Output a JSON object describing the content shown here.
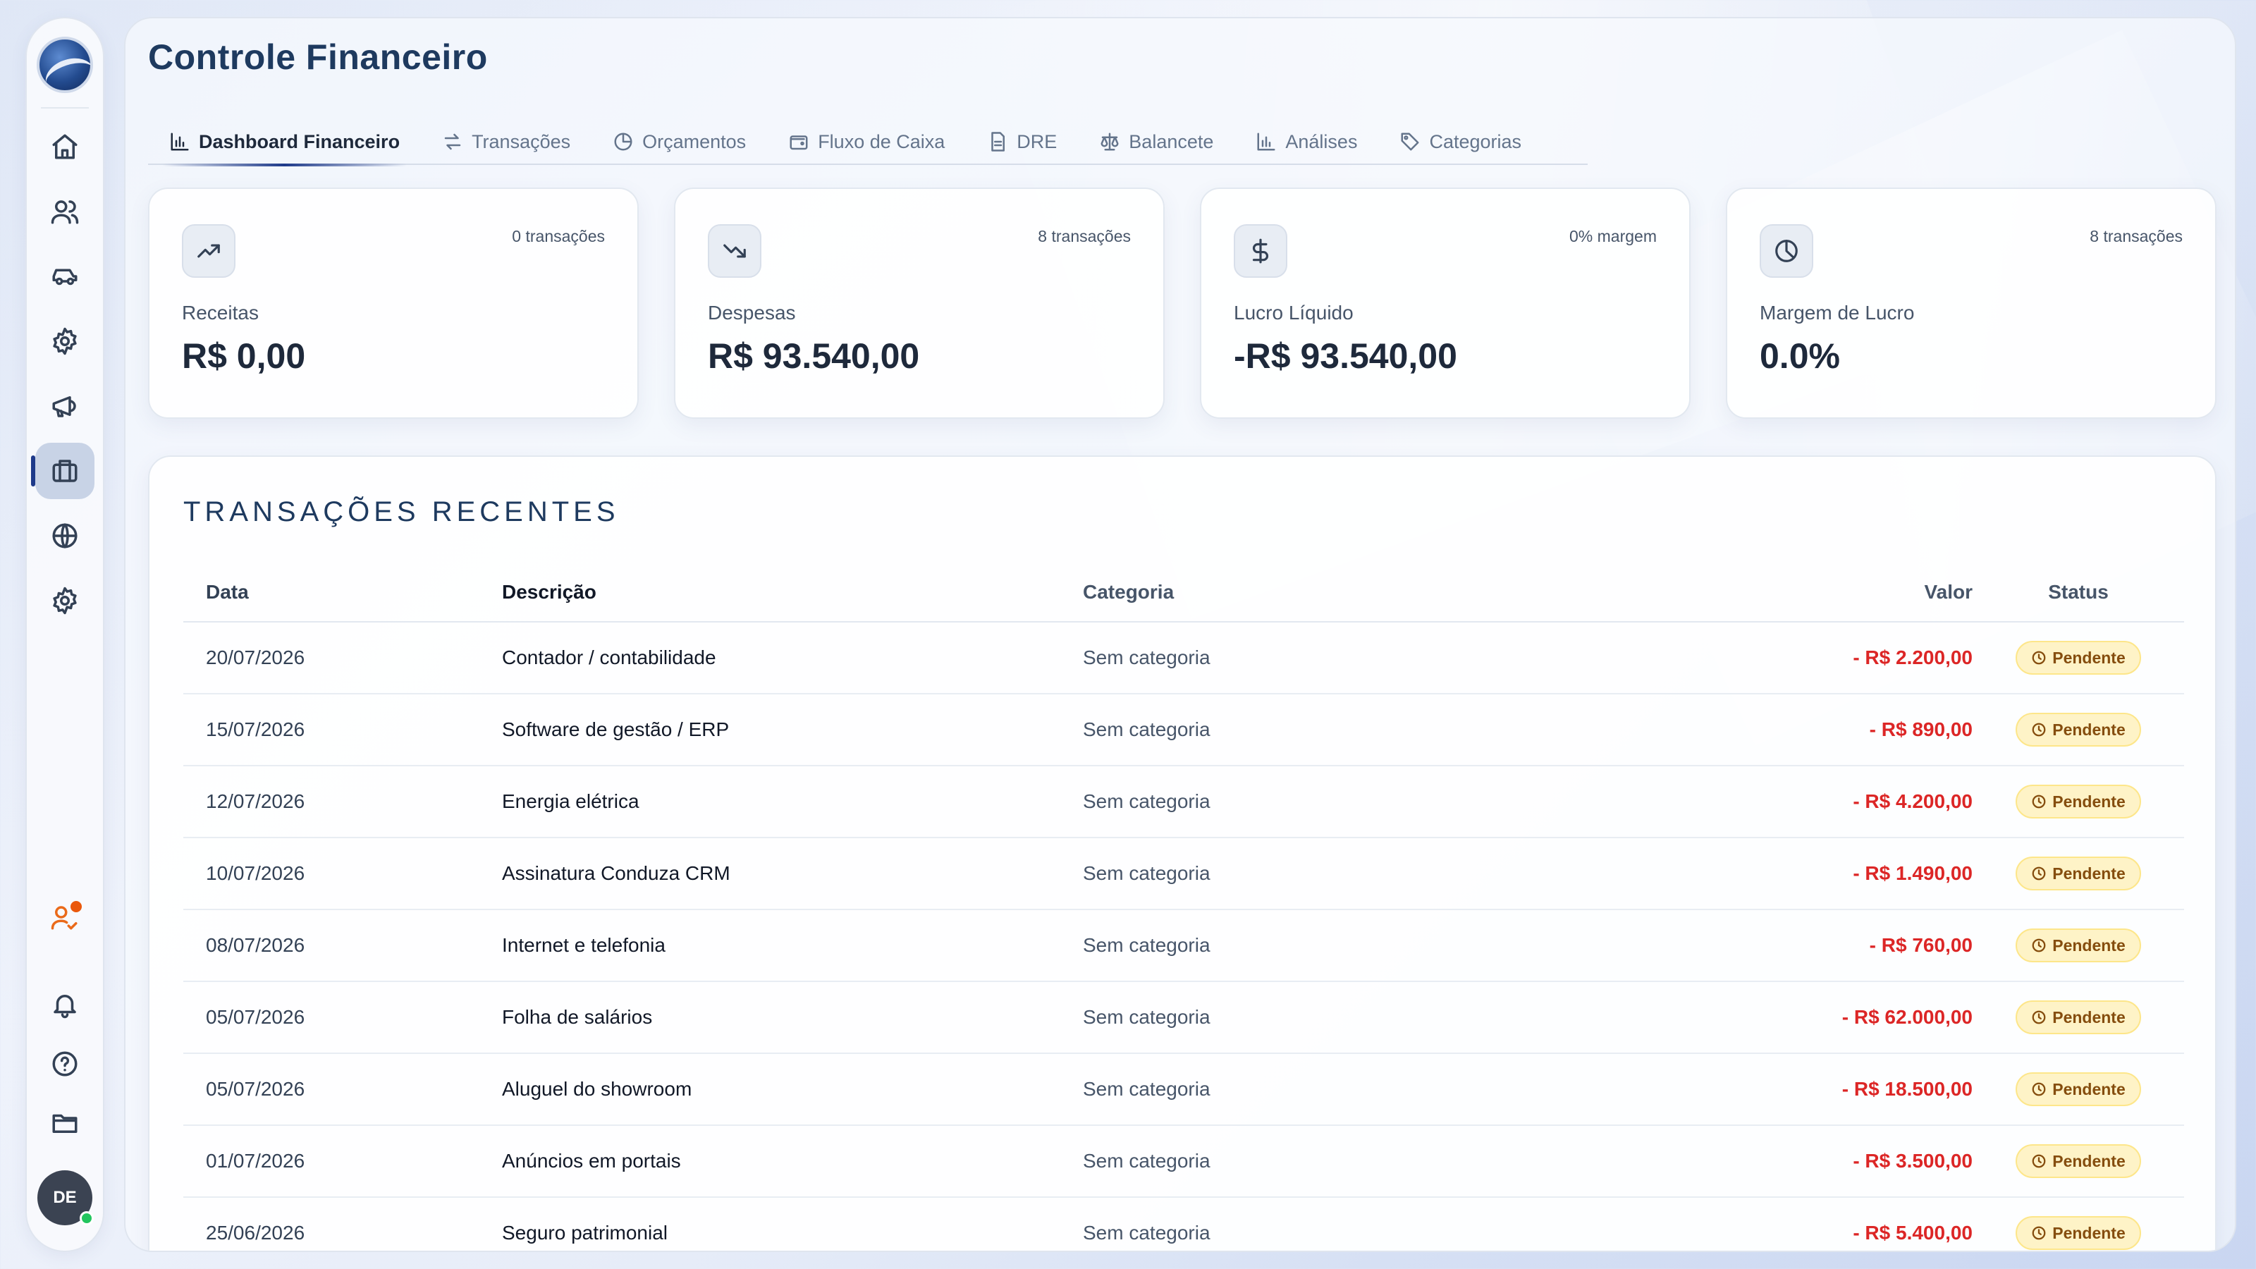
{
  "colors": {
    "accent": "#1e3a8a",
    "negative": "#dc2626",
    "pending_bg": "#fef3c7",
    "pending_text": "#854d0e",
    "notification": "#ea580c",
    "online": "#22c55e"
  },
  "sidebar": {
    "logo_icon": "company-logo",
    "items": [
      {
        "icon": "home-icon",
        "active": false
      },
      {
        "icon": "users-icon",
        "active": false
      },
      {
        "icon": "car-icon",
        "active": false
      },
      {
        "icon": "settings-icon",
        "active": false
      },
      {
        "icon": "megaphone-icon",
        "active": false
      },
      {
        "icon": "briefcase-icon",
        "active": true
      },
      {
        "icon": "globe-icon",
        "active": false
      },
      {
        "icon": "settings-icon",
        "active": false
      }
    ],
    "bottom_items": [
      {
        "icon": "user-check-icon",
        "has_notification": true
      },
      {
        "icon": "bell-icon"
      },
      {
        "icon": "help-circle-icon"
      },
      {
        "icon": "folder-icon"
      }
    ],
    "avatar_initials": "DE"
  },
  "page": {
    "title": "Controle Financeiro"
  },
  "tabs": [
    {
      "label": "Dashboard Financeiro",
      "icon": "bar-chart-icon",
      "active": true
    },
    {
      "label": "Transações",
      "icon": "arrows-exchange-icon",
      "active": false
    },
    {
      "label": "Orçamentos",
      "icon": "pie-chart-icon",
      "active": false
    },
    {
      "label": "Fluxo de Caixa",
      "icon": "wallet-icon",
      "active": false
    },
    {
      "label": "DRE",
      "icon": "file-text-icon",
      "active": false
    },
    {
      "label": "Balancete",
      "icon": "scale-icon",
      "active": false
    },
    {
      "label": "Análises",
      "icon": "bar-chart-icon",
      "active": false
    },
    {
      "label": "Categorias",
      "icon": "tag-icon",
      "active": false
    }
  ],
  "cards": [
    {
      "icon": "trending-up-icon",
      "meta": "0 transações",
      "label": "Receitas",
      "value": "R$ 0,00"
    },
    {
      "icon": "trending-down-icon",
      "meta": "8 transações",
      "label": "Despesas",
      "value": "R$ 93.540,00"
    },
    {
      "icon": "dollar-icon",
      "meta": "0% margem",
      "label": "Lucro Líquido",
      "value": "-R$ 93.540,00"
    },
    {
      "icon": "pie-chart-icon",
      "meta": "8 transações",
      "label": "Margem de Lucro",
      "value": "0.0%"
    }
  ],
  "transactions": {
    "title": "TRANSAÇÕES RECENTES",
    "columns": {
      "date": "Data",
      "description": "Descrição",
      "category": "Categoria",
      "value": "Valor",
      "status": "Status"
    },
    "rows": [
      {
        "date": "20/07/2026",
        "description": "Contador / contabilidade",
        "category": "Sem categoria",
        "value": "- R$ 2.200,00",
        "status": "Pendente"
      },
      {
        "date": "15/07/2026",
        "description": "Software de gestão / ERP",
        "category": "Sem categoria",
        "value": "- R$ 890,00",
        "status": "Pendente"
      },
      {
        "date": "12/07/2026",
        "description": "Energia elétrica",
        "category": "Sem categoria",
        "value": "- R$ 4.200,00",
        "status": "Pendente"
      },
      {
        "date": "10/07/2026",
        "description": "Assinatura Conduza CRM",
        "category": "Sem categoria",
        "value": "- R$ 1.490,00",
        "status": "Pendente"
      },
      {
        "date": "08/07/2026",
        "description": "Internet e telefonia",
        "category": "Sem categoria",
        "value": "- R$ 760,00",
        "status": "Pendente"
      },
      {
        "date": "05/07/2026",
        "description": "Folha de salários",
        "category": "Sem categoria",
        "value": "- R$ 62.000,00",
        "status": "Pendente"
      },
      {
        "date": "05/07/2026",
        "description": "Aluguel do showroom",
        "category": "Sem categoria",
        "value": "- R$ 18.500,00",
        "status": "Pendente"
      },
      {
        "date": "01/07/2026",
        "description": "Anúncios em portais",
        "category": "Sem categoria",
        "value": "- R$ 3.500,00",
        "status": "Pendente"
      },
      {
        "date": "25/06/2026",
        "description": "Seguro patrimonial",
        "category": "Sem categoria",
        "value": "- R$ 5.400,00",
        "status": "Pendente"
      }
    ]
  }
}
